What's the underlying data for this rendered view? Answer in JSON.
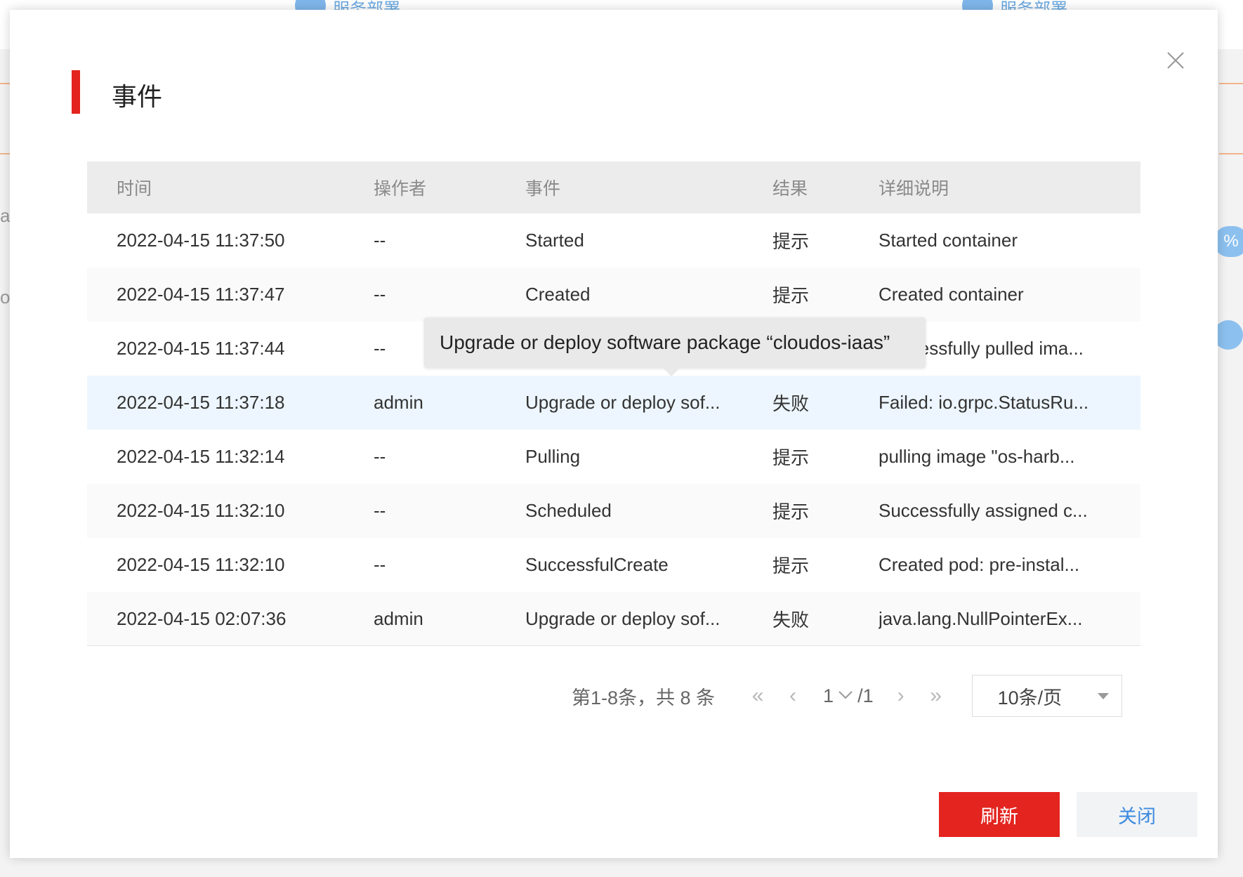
{
  "background": {
    "steps": [
      "服务部署",
      "服务部署"
    ],
    "edge_texts": [
      "a",
      "o"
    ],
    "badge": "%"
  },
  "modal": {
    "title": "事件",
    "close_symbol": "×"
  },
  "table": {
    "headers": [
      "时间",
      "操作者",
      "事件",
      "结果",
      "详细说明"
    ],
    "rows": [
      {
        "time": "2022-04-15 11:37:50",
        "operator": "--",
        "event": "Started",
        "result": "提示",
        "detail": "Started container"
      },
      {
        "time": "2022-04-15 11:37:47",
        "operator": "--",
        "event": "Created",
        "result": "提示",
        "detail": "Created container"
      },
      {
        "time": "2022-04-15 11:37:44",
        "operator": "--",
        "event": "",
        "result": "",
        "detail": "Successfully pulled ima..."
      },
      {
        "time": "2022-04-15 11:37:18",
        "operator": "admin",
        "event": "Upgrade or deploy sof...",
        "result": "失败",
        "detail": "Failed: io.grpc.StatusRu..."
      },
      {
        "time": "2022-04-15 11:32:14",
        "operator": "--",
        "event": "Pulling",
        "result": "提示",
        "detail": "pulling image \"os-harb..."
      },
      {
        "time": "2022-04-15 11:32:10",
        "operator": "--",
        "event": "Scheduled",
        "result": "提示",
        "detail": "Successfully assigned c..."
      },
      {
        "time": "2022-04-15 11:32:10",
        "operator": "--",
        "event": "SuccessfulCreate",
        "result": "提示",
        "detail": "Created pod: pre-instal..."
      },
      {
        "time": "2022-04-15 02:07:36",
        "operator": "admin",
        "event": "Upgrade or deploy sof...",
        "result": "失败",
        "detail": "java.lang.NullPointerEx..."
      }
    ]
  },
  "tooltip": {
    "text": "Upgrade or deploy software package  “cloudos-iaas”"
  },
  "pagination": {
    "summary": "第1-8条，共 8 条",
    "first": "«",
    "prev": "‹",
    "current_page": "1",
    "total_pages": "/1",
    "next": "›",
    "last": "»",
    "page_size": "10条/页"
  },
  "buttons": {
    "refresh": "刷新",
    "close": "关闭"
  },
  "colors": {
    "accent_red": "#e3241f",
    "link_blue": "#3d8ae0",
    "hover_row": "#edf6fe"
  }
}
